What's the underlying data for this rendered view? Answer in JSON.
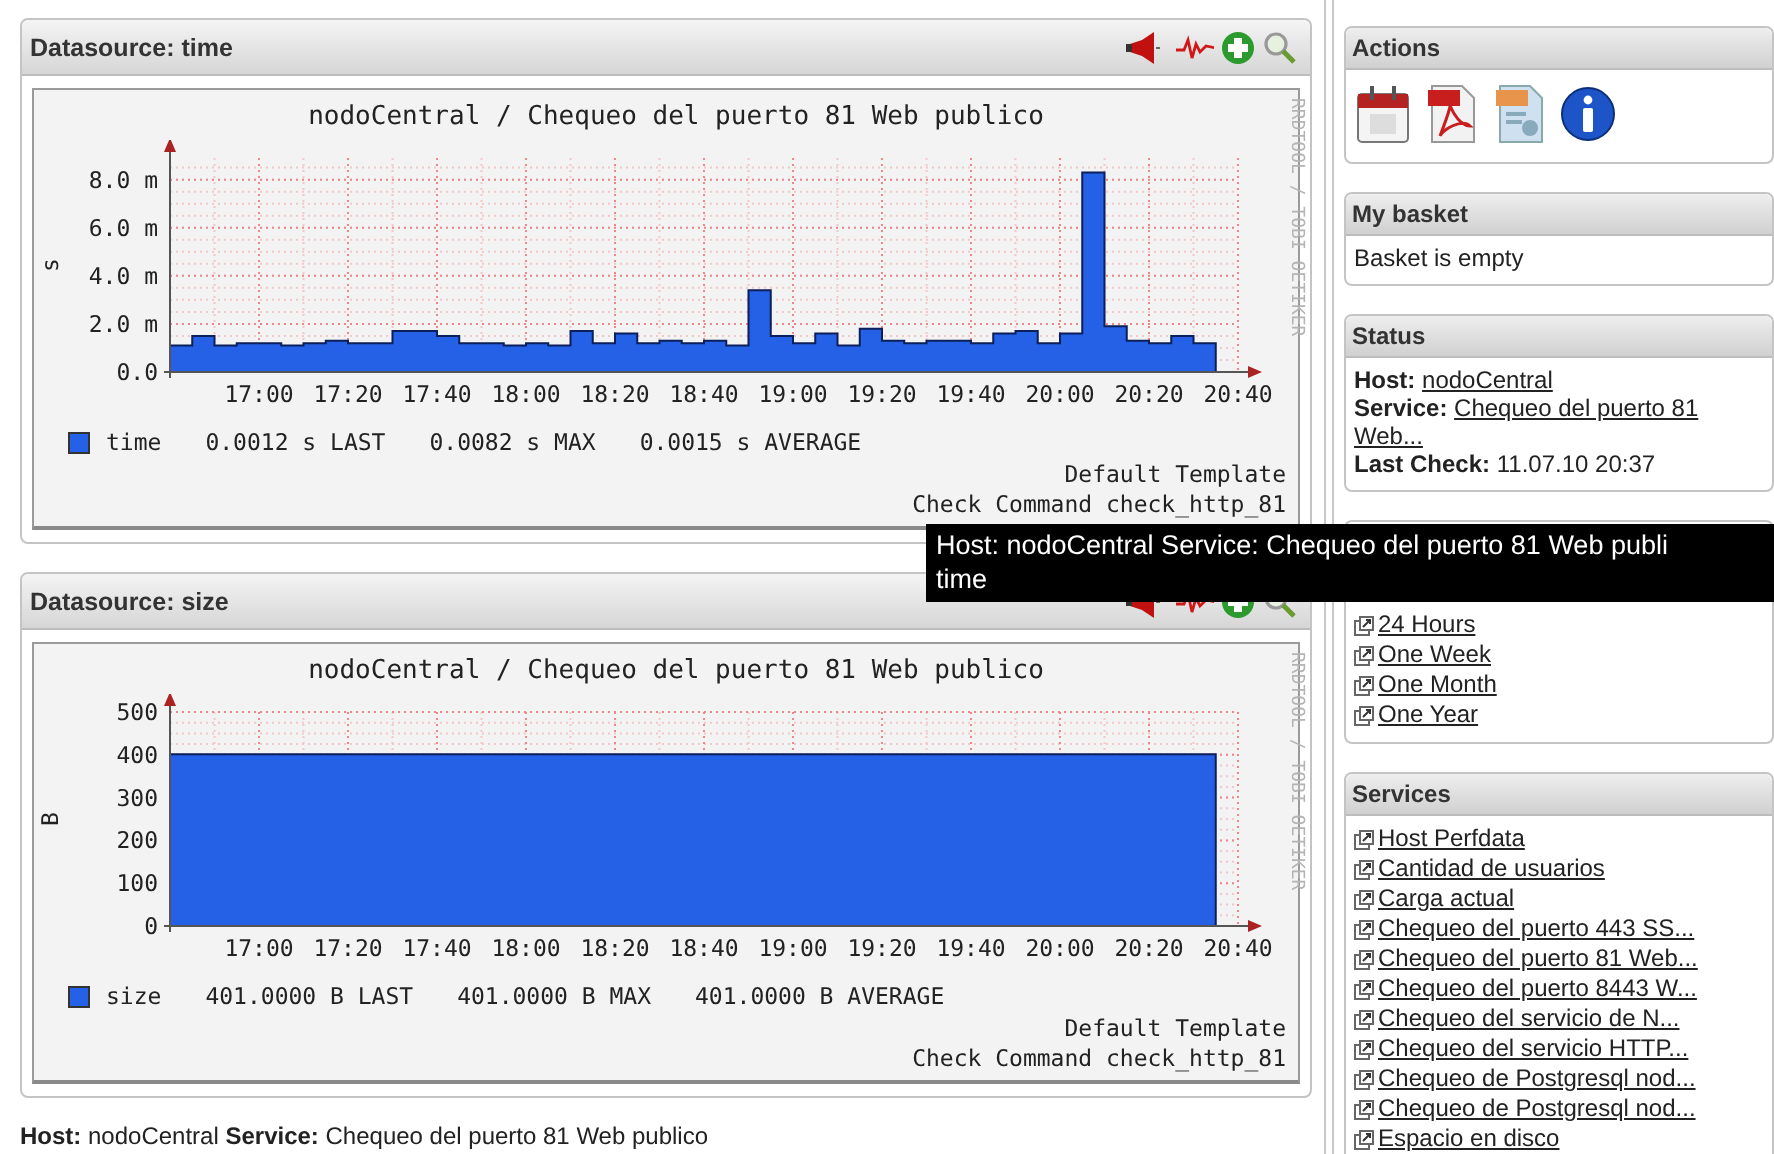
{
  "graphs": [
    {
      "title": "Datasource: time",
      "credit": "RRDTOOL / TOBI OETIKER",
      "chart_data": {
        "type": "area",
        "title": "nodoCentral / Chequeo del puerto 81 Web publico",
        "ylabel": "s",
        "categories": [
          null,
          null,
          null,
          null,
          "17:00",
          null,
          null,
          null,
          "17:20",
          null,
          null,
          null,
          "17:40",
          null,
          null,
          null,
          "18:00",
          null,
          null,
          null,
          "18:20",
          null,
          null,
          null,
          "18:40",
          null,
          null,
          null,
          "19:00",
          null,
          null,
          null,
          "19:20",
          null,
          null,
          null,
          "19:40",
          null,
          null,
          null,
          "20:00",
          null,
          null,
          null,
          "20:20",
          null,
          null,
          null,
          "20:40"
        ],
        "series": [
          {
            "name": "time",
            "color": "#2461e6",
            "values": [
              1.1,
              1.5,
              1.1,
              1.2,
              1.2,
              1.1,
              1.2,
              1.3,
              1.2,
              1.2,
              1.7,
              1.7,
              1.5,
              1.2,
              1.2,
              1.1,
              1.2,
              1.1,
              1.7,
              1.2,
              1.6,
              1.2,
              1.3,
              1.2,
              1.3,
              1.1,
              3.4,
              1.5,
              1.2,
              1.6,
              1.1,
              1.8,
              1.3,
              1.2,
              1.3,
              1.3,
              1.2,
              1.6,
              1.7,
              1.2,
              1.6,
              8.3,
              1.9,
              1.3,
              1.2,
              1.5,
              1.2,
              1.2,
              null
            ]
          }
        ],
        "grid": true,
        "ylim": [
          0,
          8.9
        ],
        "yticks": [
          {
            "value": 0,
            "label": "0.0"
          },
          {
            "value": 2,
            "label": "2.0 m"
          },
          {
            "value": 4,
            "label": "4.0 m"
          },
          {
            "value": 6,
            "label": "6.0 m"
          },
          {
            "value": 8,
            "label": "8.0 m"
          }
        ]
      },
      "stats": [
        "0.0012 s LAST",
        "0.0082 s MAX",
        "0.0015 s AVERAGE"
      ],
      "notes": [
        "Default Template",
        "Check Command check_http_81"
      ]
    },
    {
      "title": "Datasource: size",
      "credit": "RRDTOOL / TOBI OETIKER",
      "chart_data": {
        "type": "area",
        "title": "nodoCentral / Chequeo del puerto 81 Web publico",
        "ylabel": "B",
        "categories": [
          null,
          null,
          null,
          null,
          "17:00",
          null,
          null,
          null,
          "17:20",
          null,
          null,
          null,
          "17:40",
          null,
          null,
          null,
          "18:00",
          null,
          null,
          null,
          "18:20",
          null,
          null,
          null,
          "18:40",
          null,
          null,
          null,
          "19:00",
          null,
          null,
          null,
          "19:20",
          null,
          null,
          null,
          "19:40",
          null,
          null,
          null,
          "20:00",
          null,
          null,
          null,
          "20:20",
          null,
          null,
          null,
          "20:40"
        ],
        "series": [
          {
            "name": "size",
            "color": "#2461e6",
            "values": [
              401,
              401,
              401,
              401,
              401,
              401,
              401,
              401,
              401,
              401,
              401,
              401,
              401,
              401,
              401,
              401,
              401,
              401,
              401,
              401,
              401,
              401,
              401,
              401,
              401,
              401,
              401,
              401,
              401,
              401,
              401,
              401,
              401,
              401,
              401,
              401,
              401,
              401,
              401,
              401,
              401,
              401,
              401,
              401,
              401,
              401,
              401,
              401,
              null
            ]
          }
        ],
        "grid": true,
        "ylim": [
          0,
          500
        ],
        "yticks": [
          0,
          100,
          200,
          300,
          400,
          500
        ]
      },
      "stats": [
        "401.0000 B LAST",
        "401.0000 B MAX",
        "401.0000 B AVERAGE"
      ],
      "notes": [
        "Default Template",
        "Check Command check_http_81"
      ]
    }
  ],
  "footer": "**Host:** nodoCentral **Service:** Chequeo del puerto 81 Web publico",
  "tooltip": {
    "lines": [
      "Host: nodoCentral Service: Chequeo del puerto 81 Web publi",
      "time"
    ]
  },
  "sidebar": [
    {
      "kind": "blank"
    },
    {
      "kind": "actions",
      "title": "Actions"
    },
    {
      "kind": "text",
      "title": "My basket",
      "text": "Basket is empty"
    },
    {
      "kind": "status",
      "title": "Status",
      "rows": [
        {
          "label": "Host:",
          "value": "nodoCentral",
          "link": true
        },
        {
          "label": "Service:",
          "value": "Chequeo del puerto 81 Web...",
          "link": true
        },
        {
          "label": "Last Check:",
          "value": "11.07.10 20:37",
          "link": false
        }
      ]
    },
    {
      "kind": "links",
      "items": [
        "24 Hours",
        "One Week",
        "One Month",
        "One Year"
      ]
    },
    {
      "kind": "links",
      "title": "Services",
      "items": [
        "Host Perfdata",
        "Cantidad de usuarios",
        "Carga actual",
        "Chequeo del puerto 443 SS...",
        "Chequeo del puerto 81 Web...",
        "Chequeo del puerto 8443 W...",
        "Chequeo del servicio de N...",
        "Chequeo del servicio HTTP...",
        "Chequeo de Postgresql nod...",
        "Chequeo de Postgresql nod...",
        "Espacio en disco"
      ]
    }
  ]
}
